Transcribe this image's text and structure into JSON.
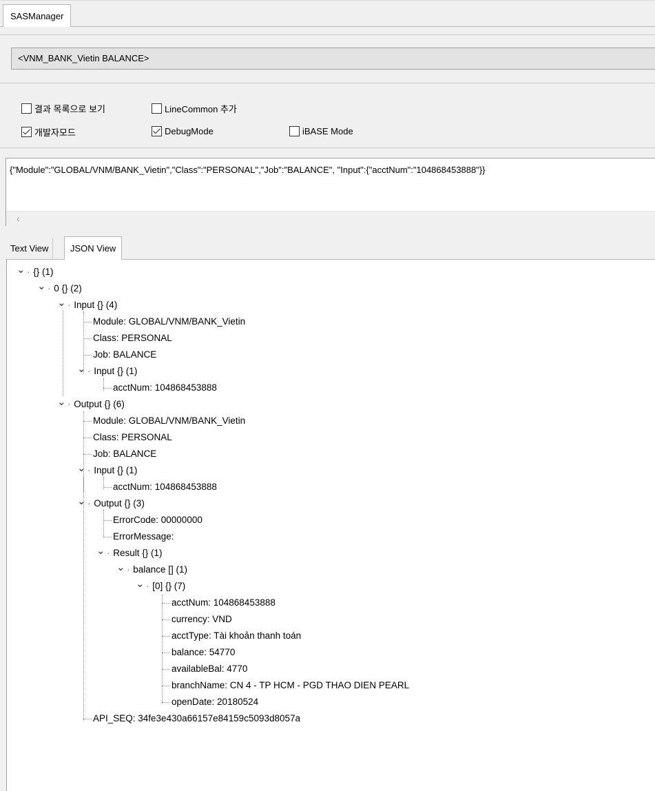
{
  "top_tab": {
    "label": "SASManager"
  },
  "module_box": {
    "value": "<VNM_BANK_Vietin BALANCE>"
  },
  "options": {
    "list_view": {
      "label": "결과 목록으로 보기",
      "checked": false
    },
    "line_common": {
      "label": "LineCommon 추가",
      "checked": false
    },
    "dev_mode": {
      "label": "개발자모드",
      "checked": true
    },
    "debug_mode": {
      "label": "DebugMode",
      "checked": true
    },
    "ibase_mode": {
      "label": "iBASE Mode",
      "checked": false
    }
  },
  "json_input": {
    "value": "{\"Module\":\"GLOBAL/VNM/BANK_Vietin\",\"Class\":\"PERSONAL\",\"Job\":\"BALANCE\", \"Input\":{\"acctNum\":\"104868453888\"}}",
    "scroll_left_icon": "chevron-left-icon"
  },
  "view_tabs": {
    "text_view": "Text View",
    "json_view": "JSON View"
  },
  "tree": {
    "root": "{} (1)",
    "n0": "0 {} (2)",
    "input": "Input {} (4)",
    "input_module": "Module: GLOBAL/VNM/BANK_Vietin",
    "input_class": "Class: PERSONAL",
    "input_job": "Job: BALANCE",
    "input_input": "Input {} (1)",
    "input_input_acct": "acctNum: 104868453888",
    "output": "Output {} (6)",
    "output_module": "Module: GLOBAL/VNM/BANK_Vietin",
    "output_class": "Class: PERSONAL",
    "output_job": "Job: BALANCE",
    "output_input": "Input {} (1)",
    "output_input_acct": "acctNum: 104868453888",
    "output_output": "Output {} (3)",
    "error_code": "ErrorCode: 00000000",
    "error_message": "ErrorMessage:",
    "result": "Result {} (1)",
    "balance_arr": "balance [] (1)",
    "item0": "[0] {} (7)",
    "acct_num": "acctNum: 104868453888",
    "currency": "currency: VND",
    "acct_type": "acctType: Tài khoản thanh toán",
    "balance": "balance: 54770",
    "available_bal": "availableBal: 4770",
    "branch_name": "branchName: CN 4 - TP HCM - PGD THAO DIEN PEARL",
    "open_date": "openDate: 20180524",
    "api_seq": "API_SEQ: 34fe3e430a66157e84159c5093d8057a"
  }
}
